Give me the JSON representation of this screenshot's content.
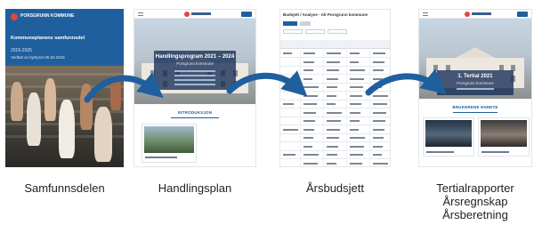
{
  "captions": {
    "samfunnsdel": "Samfunnsdelen",
    "handlingsplan": "Handlingsplan",
    "arsbudsjett": "Årsbudsjett",
    "tertial_line1": "Tertialrapporter",
    "tertial_line2": "Årsregnskap",
    "tertial_line3": "Årsberetning"
  },
  "colors": {
    "arrow": "#1f5f9e",
    "brand_blue": "#1f5f9e",
    "logo_red": "#e2453c"
  },
  "panel1": {
    "org": "PORSGRUNN KOMMUNE",
    "title": "Kommuneplanens samfunnsdel",
    "years": "2015-2025",
    "date": "Vedtatt av bystyret 05.02.2015"
  },
  "panel2": {
    "hero_title": "Handlingsprogram 2021 – 2024",
    "hero_sub": "Porsgrunn kommune",
    "section": "INTRODUKSJON"
  },
  "panel3": {
    "title": "Budsjett / Analyse - Alt Porsgrunn kommune"
  },
  "panel4": {
    "hero_title": "1. Tertial 2021",
    "hero_sub": "Porsgrunn kommune",
    "section": "BRUKERENE ENHETE"
  },
  "icons": [
    "menu-icon",
    "logo-icon",
    "arrow-icon"
  ]
}
